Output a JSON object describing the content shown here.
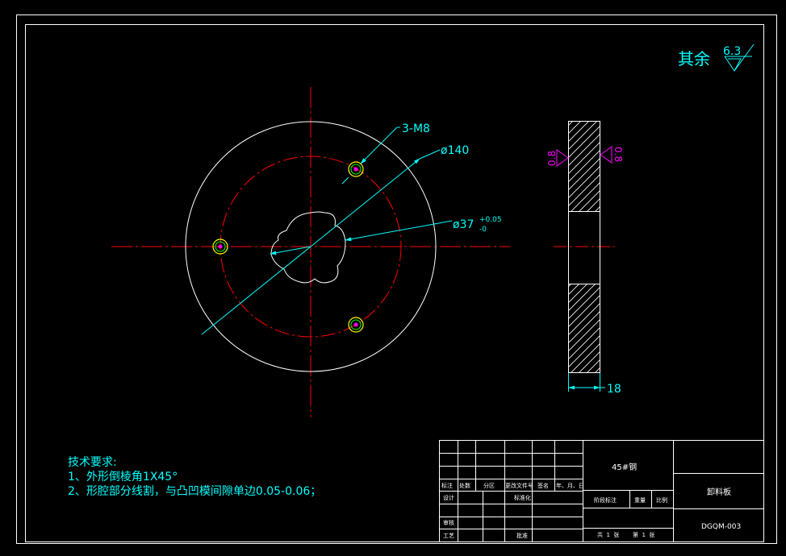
{
  "colors": {
    "background": "#000000",
    "frame": "#ffffff",
    "centerline": "#ff0000",
    "dimension": "#00ffff",
    "roughness": "#ff00ff",
    "hole": "#00ff00",
    "hole_marker": "#ff00ff",
    "hatch": "#ffffff",
    "title_text": "#ffffff"
  },
  "surface_finish": {
    "label": "其余",
    "value": "6.3"
  },
  "front_view": {
    "dims": {
      "holes": "3-M8",
      "pitch_diameter": "ø140",
      "bore": "ø37",
      "bore_tol_upper": "+0.05",
      "bore_tol_lower": "-0"
    }
  },
  "side_view": {
    "roughness_left": "0.8",
    "roughness_right": "0.8",
    "thickness": "18"
  },
  "notes": {
    "title": "技术要求:",
    "lines": [
      "1、外形倒棱角1X45°",
      "2、形腔部分线割，与凸凹模间隙单边0.05-0.06；"
    ]
  },
  "title_block": {
    "material": "45#钢",
    "part_name": "卸料板",
    "drawing_no": "DGQM-003",
    "labels": {
      "mark": "标注",
      "count": "处数",
      "zone": "分区",
      "change_doc": "更改文件号",
      "signature": "签名",
      "date": "年、月、日",
      "design": "设计",
      "standardize": "标准化",
      "review": "审核",
      "process": "工艺",
      "approve": "批准",
      "stage_mark": "阶段标注",
      "weight": "重量",
      "scale": "比例",
      "total_sheets": "共  1  张",
      "sheet_no": "第  1  张"
    }
  }
}
